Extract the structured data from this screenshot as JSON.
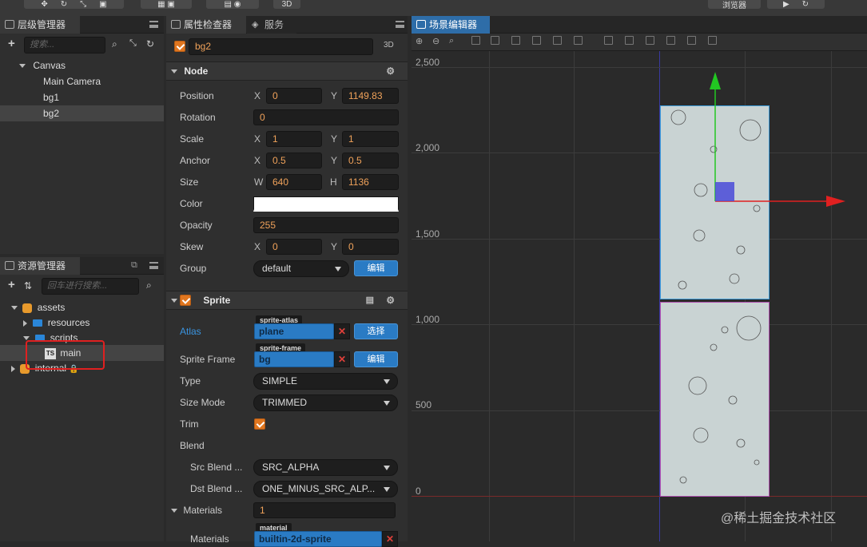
{
  "toolbar": {
    "mode_3d": "3D",
    "preview": "浏览器"
  },
  "hierarchy": {
    "title": "层级管理器",
    "search_placeholder": "搜索...",
    "nodes": [
      {
        "label": "Canvas"
      },
      {
        "label": "Main Camera"
      },
      {
        "label": "bg1"
      },
      {
        "label": "bg2"
      }
    ]
  },
  "assets": {
    "title": "资源管理器",
    "search_placeholder": "回车进行搜索...",
    "items": [
      {
        "label": "assets"
      },
      {
        "label": "resources"
      },
      {
        "label": "scripts"
      },
      {
        "label": "main",
        "badge": "TS"
      },
      {
        "label": "internal"
      }
    ]
  },
  "inspector": {
    "tab_title": "属性检查器",
    "tab2_title": "服务",
    "node_name": "bg2",
    "mode_3d": "3D",
    "node_section": "Node",
    "position": {
      "label": "Position",
      "x_label": "X",
      "x": "0",
      "y_label": "Y",
      "y": "1149.83"
    },
    "rotation": {
      "label": "Rotation",
      "value": "0"
    },
    "scale": {
      "label": "Scale",
      "x_label": "X",
      "x": "1",
      "y_label": "Y",
      "y": "1"
    },
    "anchor": {
      "label": "Anchor",
      "x_label": "X",
      "x": "0.5",
      "y_label": "Y",
      "y": "0.5"
    },
    "size": {
      "label": "Size",
      "w_label": "W",
      "w": "640",
      "h_label": "H",
      "h": "1136"
    },
    "color": {
      "label": "Color",
      "value": "#ffffff"
    },
    "opacity": {
      "label": "Opacity",
      "value": "255"
    },
    "skew": {
      "label": "Skew",
      "x_label": "X",
      "x": "0",
      "y_label": "Y",
      "y": "0"
    },
    "group": {
      "label": "Group",
      "value": "default",
      "button": "编辑"
    },
    "sprite_section": "Sprite",
    "atlas": {
      "label": "Atlas",
      "tag": "sprite-atlas",
      "value": "plane",
      "button": "选择"
    },
    "sprite_frame": {
      "label": "Sprite Frame",
      "tag": "sprite-frame",
      "value": "bg",
      "button": "编辑"
    },
    "type": {
      "label": "Type",
      "value": "SIMPLE"
    },
    "size_mode": {
      "label": "Size Mode",
      "value": "TRIMMED"
    },
    "trim": {
      "label": "Trim",
      "checked": true
    },
    "blend": {
      "label": "Blend"
    },
    "src_blend": {
      "label": "Src Blend ...",
      "value": "SRC_ALPHA"
    },
    "dst_blend": {
      "label": "Dst Blend ...",
      "value": "ONE_MINUS_SRC_ALP..."
    },
    "materials": {
      "label": "Materials",
      "value": "1"
    },
    "materials_item": {
      "label": "Materials",
      "tag": "material",
      "value": "builtin-2d-sprite"
    }
  },
  "scene": {
    "title": "场景编辑器",
    "y_ticks": [
      "2,500",
      "2,000",
      "1,500",
      "1,000",
      "500",
      "0"
    ]
  },
  "watermark": "@稀土掘金技术社区",
  "colors": {
    "accent": "#2a7bc4",
    "highlight": "#f0a25a",
    "check": "#e0761f",
    "annotation": "#e02020"
  }
}
